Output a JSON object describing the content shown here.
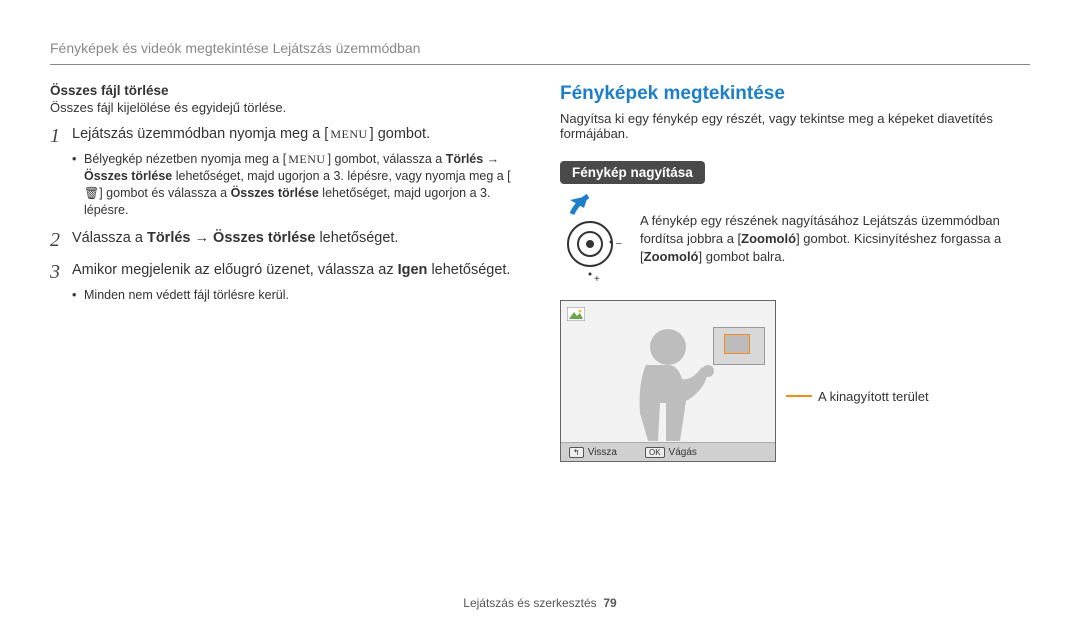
{
  "header": {
    "breadcrumb": "Fényképek és videók megtekintése Lejátszás üzemmódban"
  },
  "left": {
    "title": "Összes fájl törlése",
    "subtitle": "Összes fájl kijelölése és egyidejű törlése.",
    "step1": {
      "pre": "Lejátszás üzemmódban nyomja meg a [",
      "menu": "MENU",
      "post": "] gombot."
    },
    "step1_sub": {
      "l1a": "Bélyegkép nézetben nyomja meg a [",
      "l1_menu": "MENU",
      "l1b": "] gombot, válassza a ",
      "l1_bold1": "Törlés",
      "l1_arrow": " → ",
      "l2_bold": "Összes törlése",
      "l2_rest": " lehetőséget, majd ugorjon a 3. lépésre, vagy nyomja meg a [",
      "l3_trash": "🗑",
      "l3_mid": "] gombot és válassza a ",
      "l3_bold": "Összes törlése",
      "l3_rest": " lehetőséget, majd ugorjon a 3. lépésre."
    },
    "step2": {
      "pre": "Válassza a ",
      "b1": "Törlés",
      "arrow": " → ",
      "b2": "Összes törlése",
      "post": " lehetőséget."
    },
    "step3": {
      "pre": "Amikor megjelenik az előugró üzenet, válassza az ",
      "b": "Igen",
      "post": " lehetőséget."
    },
    "step3_sub": "Minden nem védett fájl törlésre kerül."
  },
  "right": {
    "title": "Fényképek megtekintése",
    "intro": "Nagyítsa ki egy fénykép egy részét, vagy tekintse meg a képeket diavetítés formájában.",
    "pill": "Fénykép nagyítása",
    "zoom": {
      "l1": "A fénykép egy részének nagyításához Lejátszás üzemmódban fordítsa jobbra a [",
      "b1": "Zoomoló",
      "l1b": "] gombot. Kicsinyítéshez forgassa a [",
      "b2": "Zoomoló",
      "l1c": "] gombot balra."
    },
    "screen": {
      "back": "Vissza",
      "crop": "Vágás",
      "back_icon": "↰",
      "ok_icon": "OK"
    },
    "area_label": "A kinagyított terület"
  },
  "footer": {
    "text": "Lejátszás és szerkesztés",
    "page": "79"
  }
}
